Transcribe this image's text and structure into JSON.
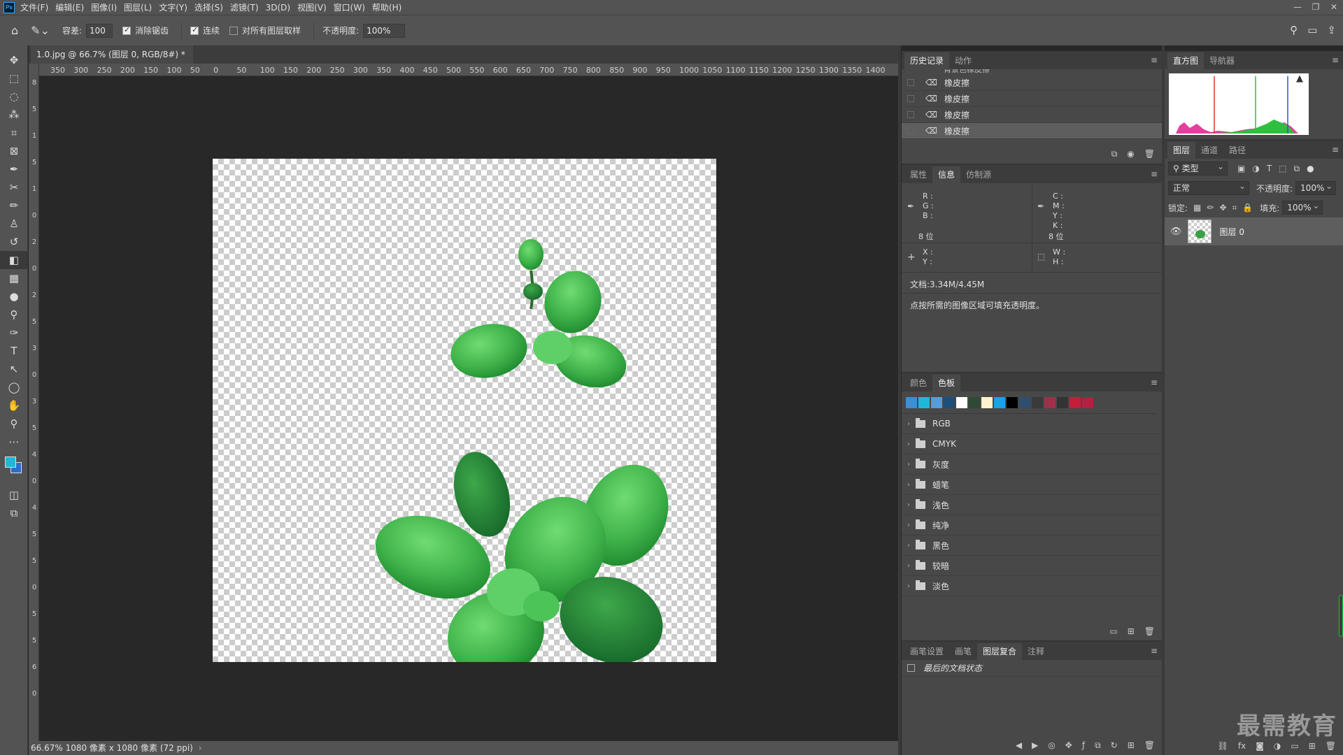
{
  "app": {
    "logo": "Ps",
    "menus": [
      "文件(F)",
      "编辑(E)",
      "图像(I)",
      "图层(L)",
      "文字(Y)",
      "选择(S)",
      "滤镜(T)",
      "3D(D)",
      "视图(V)",
      "窗口(W)",
      "帮助(H)"
    ],
    "window_controls": [
      "—",
      "❐",
      "✕"
    ]
  },
  "options": {
    "tolerance_label": "容差:",
    "tolerance_value": "100",
    "antialias_label": "消除锯齿",
    "contiguous_label": "连续",
    "sample_all_label": "对所有图层取样",
    "opacity_label": "不透明度:",
    "opacity_value": "100%"
  },
  "document": {
    "tab_title": "1.0.jpg @ 66.7% (图层 0, RGB/8#) *",
    "close": "×",
    "status": "66.67%  1080 像素 x 1080 像素 (72 ppi)"
  },
  "ruler": {
    "h_labels": [
      "350",
      "300",
      "250",
      "200",
      "150",
      "100",
      "50",
      "0",
      "50",
      "100",
      "150",
      "200",
      "250",
      "300",
      "350",
      "400",
      "450",
      "500",
      "550",
      "600",
      "650",
      "700",
      "750",
      "800",
      "850",
      "900",
      "950",
      "1000",
      "1050",
      "1100",
      "1150",
      "1200",
      "1250",
      "1300",
      "1350",
      "1400"
    ],
    "v_labels": [
      "8",
      "5",
      "1",
      "5",
      "1",
      "0",
      "2",
      "0",
      "2",
      "5",
      "3",
      "0",
      "3",
      "5",
      "4",
      "0",
      "4",
      "5",
      "5",
      "0",
      "5",
      "5",
      "6",
      "0"
    ]
  },
  "history": {
    "tabs": [
      "历史记录",
      "动作"
    ],
    "items": [
      {
        "label": "背景色橡皮擦",
        "selected": false
      },
      {
        "label": "橡皮擦",
        "selected": false
      },
      {
        "label": "橡皮擦",
        "selected": false
      },
      {
        "label": "橡皮擦",
        "selected": false
      },
      {
        "label": "橡皮擦",
        "selected": true
      }
    ]
  },
  "histogram": {
    "tabs": [
      "直方图",
      "导航器"
    ]
  },
  "info": {
    "tabs": [
      "属性",
      "信息",
      "仿制源"
    ],
    "rgb": [
      "R :",
      "G :",
      "B :"
    ],
    "cmyk": [
      "C :",
      "M :",
      "Y :",
      "K :"
    ],
    "bits_left": "8 位",
    "bits_right": "8 位",
    "xy": [
      "X :",
      "Y :"
    ],
    "wh": [
      "W :",
      "H :"
    ],
    "doc_size": "文档:3.34M/4.45M",
    "hint": "点按所需的图像区域可填充透明度。"
  },
  "swatches": {
    "tabs": [
      "颜色",
      "色板"
    ],
    "colors": [
      "#3a8fd6",
      "#1fb8d6",
      "#5b9bd5",
      "#1f4e79",
      "#ffffff",
      "#2e4a35",
      "#fff2cc",
      "#1ea0e6",
      "#000000",
      "#2f4f6f",
      "#3a3a3a",
      "#a0304a",
      "#333333",
      "#c41e3a",
      "#b0223f"
    ],
    "groups": [
      "RGB",
      "CMYK",
      "灰度",
      "蜡笔",
      "浅色",
      "纯净",
      "黑色",
      "较暗",
      "淡色"
    ]
  },
  "comps": {
    "tabs": [
      "画笔设置",
      "画笔",
      "图层复合",
      "注释"
    ],
    "item": "最后的文档状态"
  },
  "layers": {
    "tabs": [
      "图层",
      "通道",
      "路径"
    ],
    "filter": "类型",
    "blend": "正常",
    "opacity_label": "不透明度:",
    "opacity_value": "100%",
    "lock_label": "锁定:",
    "fill_label": "填充:",
    "fill_value": "100%",
    "layer_name": "图层 0"
  },
  "watermark": "最需教育",
  "colors": {
    "foreground": "#1fb8d6",
    "background": "#2a6fc9",
    "leaf_light": "#5fd068",
    "leaf_dark": "#1f8a2e"
  }
}
